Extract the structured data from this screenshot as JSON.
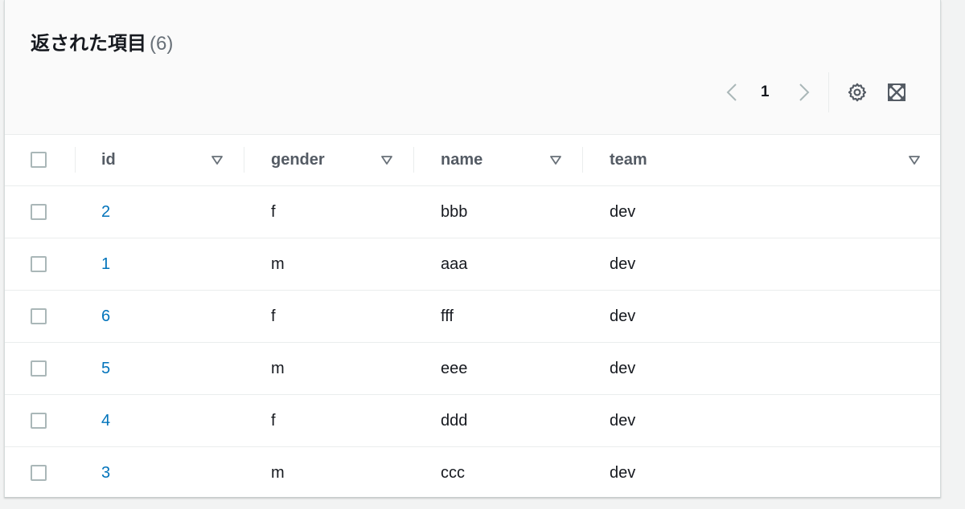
{
  "header": {
    "title": "返された項目",
    "count": "(6)"
  },
  "pagination": {
    "current_page": "1",
    "prev_icon": "chevron-left-icon",
    "next_icon": "chevron-right-icon"
  },
  "toolbar": {
    "settings_icon": "gear-icon",
    "fullscreen_icon": "fullscreen-icon"
  },
  "table": {
    "columns": [
      "id",
      "gender",
      "name",
      "team"
    ],
    "rows": [
      {
        "id": "2",
        "gender": "f",
        "name": "bbb",
        "team": "dev"
      },
      {
        "id": "1",
        "gender": "m",
        "name": "aaa",
        "team": "dev"
      },
      {
        "id": "6",
        "gender": "f",
        "name": "fff",
        "team": "dev"
      },
      {
        "id": "5",
        "gender": "m",
        "name": "eee",
        "team": "dev"
      },
      {
        "id": "4",
        "gender": "f",
        "name": "ddd",
        "team": "dev"
      },
      {
        "id": "3",
        "gender": "m",
        "name": "ccc",
        "team": "dev"
      }
    ]
  },
  "colors": {
    "link": "#0073bb",
    "header_text": "#545b64",
    "border": "#eaeded",
    "panel_header_bg": "#fafafa"
  }
}
